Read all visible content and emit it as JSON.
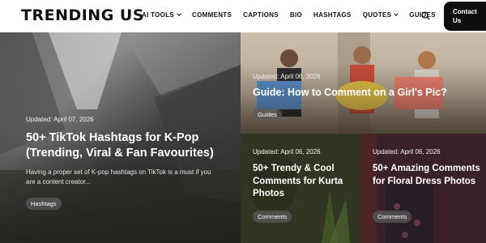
{
  "header": {
    "logo": "TRENDING US",
    "nav": [
      "AI TOOLS",
      "COMMENTS",
      "CAPTIONS",
      "BIO",
      "HASHTAGS",
      "QUOTES",
      "GUIDES"
    ],
    "contact_line1": "Contact",
    "contact_line2": "Us"
  },
  "cards": {
    "main": {
      "date": "Updated: April 07, 2026",
      "title": "50+ TikTok Hashtags for K-Pop (Trending, Viral & Fan Favourites)",
      "excerpt": "Having a proper set of K-pop hashtags on TikTok is a must if you are a content creator...",
      "tag": "Hashtags"
    },
    "top": {
      "date": "Updated: April 06, 2026",
      "title": "Guide: How to Comment on a Girl's Pic?",
      "tag": "Guides"
    },
    "bottom_left": {
      "date": "Updated: April 06, 2026",
      "title": "50+ Trendy & Cool Comments for Kurta Photos",
      "tag": "Comments"
    },
    "bottom_right": {
      "date": "Updated: April 06, 2026",
      "title": "50+ Amazing Comments for Floral Dress Photos",
      "tag": "Comments"
    }
  },
  "colors": {
    "accent": "#0e0e0e",
    "tag_bg": "#5a5a5a"
  },
  "icons": {
    "search": "search-icon",
    "dropdown": "chevron-down-icon"
  }
}
